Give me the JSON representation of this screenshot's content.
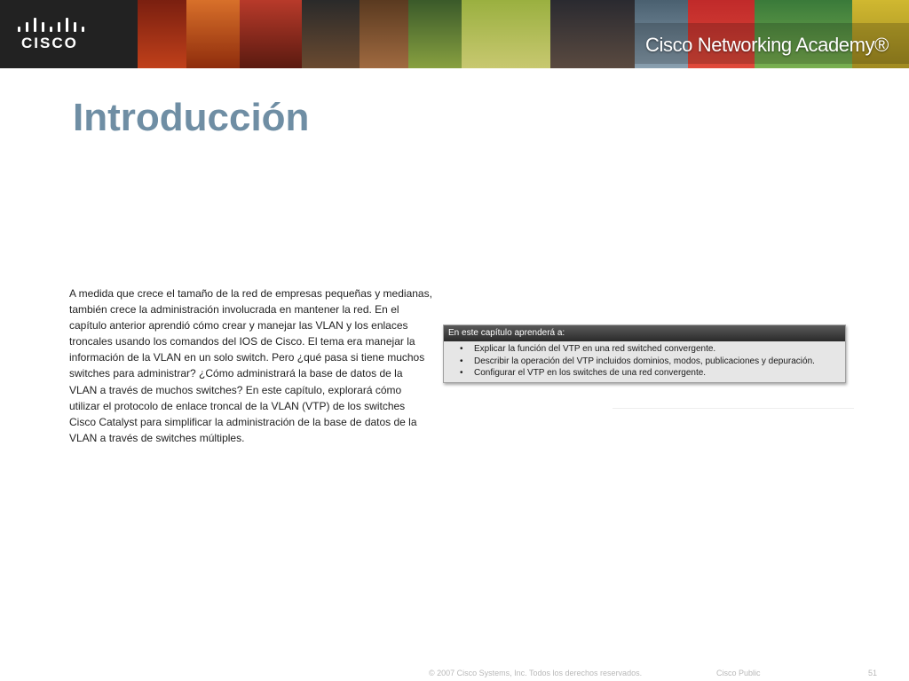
{
  "header": {
    "logo_text": "CISCO",
    "academy_name": "Cisco Networking Academy®"
  },
  "slide": {
    "title": "Introducción",
    "intro_paragraph": "A medida que crece el tamaño de la red de empresas pequeñas y medianas, también crece la administración involucrada en mantener la red. En el capítulo anterior aprendió cómo crear y manejar las VLAN y los enlaces troncales usando los comandos del IOS de Cisco. El tema era manejar la información de la VLAN en un solo switch. Pero ¿qué pasa si tiene muchos switches para administrar? ¿Cómo administrará la base de datos de la VLAN a través de muchos switches? En este capítulo, explorará cómo utilizar el protocolo de enlace troncal de la VLAN (VTP) de los switches Cisco Catalyst para simplificar la administración de la base de datos de la VLAN a través de switches múltiples."
  },
  "objectives": {
    "header": "En este capítulo aprenderá a:",
    "bullet_symbol": "•",
    "items": [
      "Explicar la función del VTP en una red switched convergente.",
      "Describir la operación del VTP incluidos dominios, modos, publicaciones y depuración.",
      "Configurar el VTP en los switches de una red convergente."
    ]
  },
  "footer": {
    "copyright": "© 2007 Cisco Systems, Inc. Todos los derechos reservados.",
    "classification": "Cisco Public",
    "page_number": "51"
  },
  "colors": {
    "title": "#6f8ea4",
    "body_text": "#222222",
    "footer_text": "#b8b8b8",
    "objectives_bg": "#e6e6e6",
    "objectives_header_bg": "#3a3a3a"
  }
}
